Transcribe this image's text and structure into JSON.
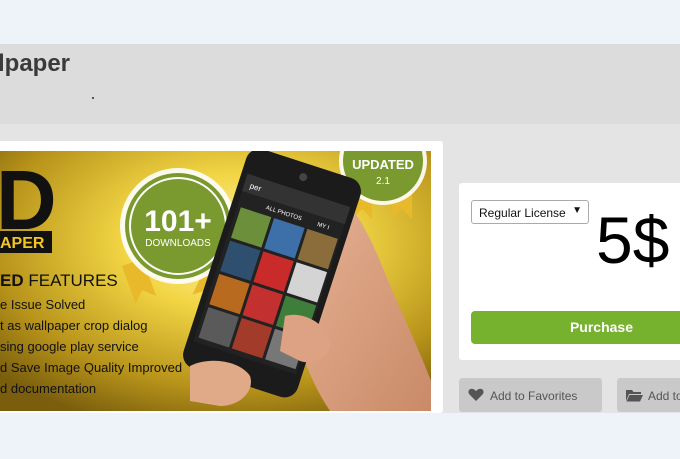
{
  "header": {
    "title": "lpaper"
  },
  "banner": {
    "big_letter": "D",
    "tag_text": "APER",
    "features_heading_bold": "ED",
    "features_heading_rest": " FEATURES",
    "features": [
      "e Issue Solved",
      "t as wallpaper crop dialog",
      "sing google play service",
      "d Save Image Quality Improved",
      "d documentation"
    ],
    "badge_count": "101+",
    "badge_label": "DOWNLOADS",
    "updated_label": "UPDATED",
    "updated_version": "2.1",
    "phone_tab_all": "ALL PHOTOS",
    "phone_tab_my": "MY I",
    "phone_title": "per"
  },
  "purchase_panel": {
    "license": "Regular License",
    "price": "5$",
    "purchase_label": "Purchase"
  },
  "actions": {
    "favorites_label": "Add to Favorites",
    "collection_label": "Add to"
  },
  "colors": {
    "accent_green": "#77b22f",
    "badge_green": "#7a9a2f",
    "ribbon_gold": "#e9b92c"
  }
}
